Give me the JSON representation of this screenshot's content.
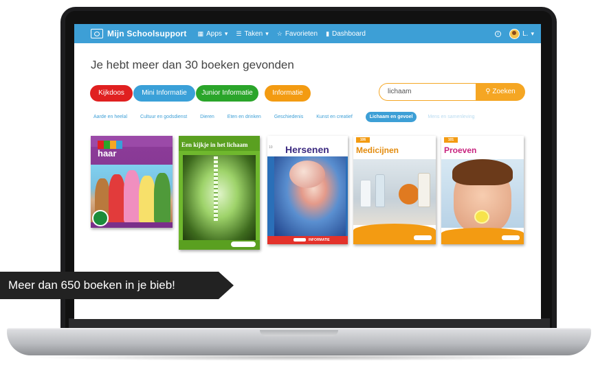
{
  "navbar": {
    "brand": "Mijn Schoolsupport",
    "items": [
      {
        "label": "Apps",
        "icon": "grid-icon",
        "has_dropdown": true
      },
      {
        "label": "Taken",
        "icon": "list-icon",
        "has_dropdown": true
      },
      {
        "label": "Favorieten",
        "icon": "star-icon",
        "has_dropdown": false
      },
      {
        "label": "Dashboard",
        "icon": "bar-chart-icon",
        "has_dropdown": false
      }
    ],
    "user_name": "L.",
    "info_symbol": "i"
  },
  "heading": "Je hebt meer dan 30 boeken gevonden",
  "categories": [
    {
      "label": "Kijkdoos",
      "color": "#e02020"
    },
    {
      "label": "Mini Informatie",
      "color": "#3aa0d8"
    },
    {
      "label": "Junior Informatie",
      "color": "#2aa52a"
    },
    {
      "label": "Informatie",
      "color": "#f39b12"
    }
  ],
  "search": {
    "value": "lichaam",
    "button_label": "Zoeken"
  },
  "subnav": {
    "items": [
      "Aarde en heelal",
      "Cultuur en godsdienst",
      "Dieren",
      "Eten en drinken",
      "Geschiedenis",
      "Kunst en creatief"
    ],
    "active": "Lichaam en gevoel",
    "after": [
      "Mens en samenleving"
    ]
  },
  "books": [
    {
      "title": "haar",
      "series_letters": "Nell"
    },
    {
      "title": "Een kijkje in het lichaam"
    },
    {
      "title": "Hersenen",
      "number": "10",
      "series_label": "INFORMATIE"
    },
    {
      "title": "Medicijnen",
      "number": "106"
    },
    {
      "title": "Proeven",
      "number": "101"
    }
  ],
  "banner": "Meer dan 650 boeken in je bieb!",
  "colors": {
    "navbar": "#3d9fd6",
    "search_accent": "#f5a623",
    "banner_bg": "#222222"
  }
}
